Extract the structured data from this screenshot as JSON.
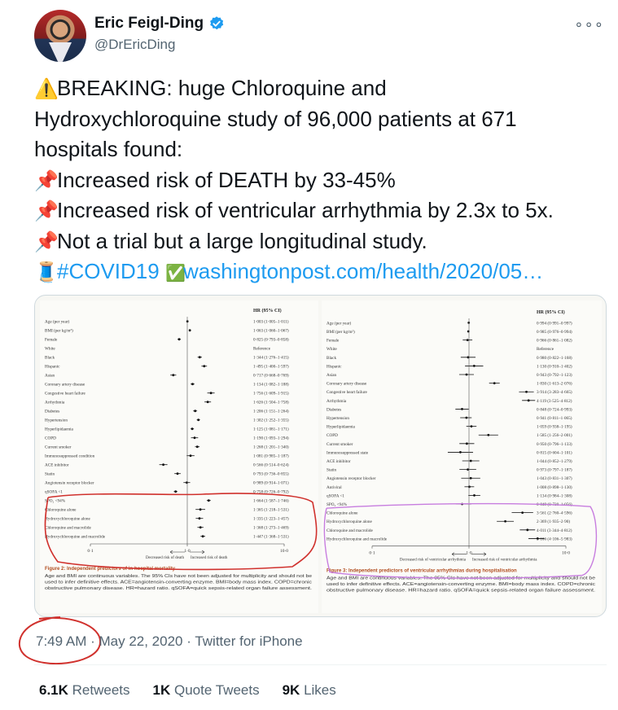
{
  "author": {
    "name": "Eric Feigl-Ding",
    "handle": "@DrEricDing",
    "avatar_icon": "profile-photo",
    "verified_icon": "verified-badge-icon",
    "more_icon": "more-dots-icon"
  },
  "tweet": {
    "line1_emoji": "⚠️",
    "line1_text": "BREAKING: huge Chloroquine and",
    "line2_text": "Hydroxychloroquine study of 96,000 patients at 671",
    "line3_text": "hospitals found:",
    "pin_emoji": "📌",
    "line4_text": "Increased risk of DEATH by 33-45%",
    "line5_text": "Increased risk of ventricular arrhythmia by 2.3x to 5x.",
    "line6_text": "Not a trial but a large longitudinal study.",
    "thread_emoji": "🧵",
    "hashtag": "#COVID19",
    "check_emoji": "✅",
    "link_text": "washingtonpost.com/health/2020/05…"
  },
  "figure_left": {
    "header": "HR (95% CI)",
    "rows": [
      {
        "label": "Age (per year)",
        "ci": "1·003 (1·005–1·011)"
      },
      {
        "label": "BMI (per kg/m²)",
        "ci": "1·063 (1·060–1·067)"
      },
      {
        "label": "Female",
        "ci": "0·825 (0·793–0·858)"
      },
      {
        "label": "White",
        "ci": "Reference"
      },
      {
        "label": "Black",
        "ci": "1·344 (1·276–1·415)"
      },
      {
        "label": "Hispanic",
        "ci": "1·495 (1·400–1·597)"
      },
      {
        "label": "Asian",
        "ci": "0·717 (0·668–0·769)"
      },
      {
        "label": "Coronary artery disease",
        "ci": "1·134 (1·082–1·188)"
      },
      {
        "label": "Congestive heart failure",
        "ci": "1·756 (1·609–1·915)"
      },
      {
        "label": "Arrhythmia",
        "ci": "1·626 (1·504–1·758)"
      },
      {
        "label": "Diabetes",
        "ci": "1·206 (1·151–1·264)"
      },
      {
        "label": "Hypertension",
        "ci": "1·302 (1·252–1·355)"
      },
      {
        "label": "Hyperlipidaemia",
        "ci": "1·125 (1·081–1·171)"
      },
      {
        "label": "COPD",
        "ci": "1·190 (1·093–1·294)"
      },
      {
        "label": "Current smoker",
        "ci": "1·268 (1·201–1·340)"
      },
      {
        "label": "Immunosuppressed condition",
        "ci": "1·081 (0·985–1·187)"
      },
      {
        "label": "ACE inhibitor",
        "ci": "0·566 (0·514–0·624)"
      },
      {
        "label": "Statin",
        "ci": "0·793 (0·736–0·855)"
      },
      {
        "label": "Angiotensin receptor blocker",
        "ci": "0·989 (0·914–1·071)"
      },
      {
        "label": "qSOFA <1",
        "ci": "0·758 (0·726–0·792)"
      },
      {
        "label": "SPO₂ <94%",
        "ci": "1·664 (1·587–1·746)"
      },
      {
        "label": "Chloroquine alone",
        "ci": "1·365 (1·218–1·531)"
      },
      {
        "label": "Hydroxychloroquine alone",
        "ci": "1·335 (1·223–1·457)"
      },
      {
        "label": "Chloroquine and macrolide",
        "ci": "1·368 (1·273–1·469)"
      },
      {
        "label": "Hydroxychloroquine and macrolide",
        "ci": "1·447 (1·368–1·531)"
      }
    ],
    "axis_ticks": [
      "0·1",
      "1·0",
      "10·0"
    ],
    "axis_left_label": "Decreased risk of death",
    "axis_right_label": "Increased risk of death",
    "caption_title": "Figure 2: Independent predictors of in-hospital mortality",
    "caption_body": [
      "Age and BMI are continuous variables. The 95% CIs have not been adjusted for multiplicity and should not be",
      "used to infer definitive effects. ACE=angiotensin-converting enzyme. BMI=body mass index. COPD=chronic",
      "obstructive pulmonary disease. HR=hazard ratio. qSOFA=quick sepsis-related organ failure assessment."
    ]
  },
  "figure_right": {
    "header": "HR (95% CI)",
    "rows": [
      {
        "label": "Age (per year)",
        "ci": "0·994 (0·991–0·997)"
      },
      {
        "label": "BMI (per kg/m²)",
        "ci": "0·985 (0·976–0·994)"
      },
      {
        "label": "Female",
        "ci": "0·966 (0·861–1·082)"
      },
      {
        "label": "White",
        "ci": "Reference"
      },
      {
        "label": "Black",
        "ci": "0·980 (0·822–1·168)"
      },
      {
        "label": "Hispanic",
        "ci": "1·130 (0·910–1·402)"
      },
      {
        "label": "Asian",
        "ci": "0·943 (0·792–1·123)"
      },
      {
        "label": "Coronary artery disease",
        "ci": "1·830 (1·613–2·076)"
      },
      {
        "label": "Congestive heart failure",
        "ci": "3·914 (3·283–4·665)"
      },
      {
        "label": "Arrhythmia",
        "ci": "4·119 (3·525–4·812)"
      },
      {
        "label": "Diabetes",
        "ci": "0·848 (0·724–0·993)"
      },
      {
        "label": "Hypertension",
        "ci": "0·941 (0·811–1·065)"
      },
      {
        "label": "Hyperlipidaemia",
        "ci": "1·059 (0·938–1·195)"
      },
      {
        "label": "COPD",
        "ci": "1·585 (1·256–2·001)"
      },
      {
        "label": "Current smoker",
        "ci": "0·950 (0·796–1·133)"
      },
      {
        "label": "Immunosuppressed state",
        "ci": "0·815 (0·604–1·101)"
      },
      {
        "label": "ACE inhibitor",
        "ci": "1·044 (0·852–1·279)"
      },
      {
        "label": "Statin",
        "ci": "0·973 (0·797–1·187)"
      },
      {
        "label": "Angiotensin receptor blocker",
        "ci": "1·043 (0·831–1·307)"
      },
      {
        "label": "Antiviral",
        "ci": "1·008 (0·898–1·130)"
      },
      {
        "label": "qSOFA <1",
        "ci": "1·134 (0·984–1·308)"
      },
      {
        "label": "SPO₂ <94%",
        "ci": "0·849 (0·730–1·056)"
      },
      {
        "label": "Chloroquine alone",
        "ci": "3·561 (2·760–4·596)"
      },
      {
        "label": "Hydroxychloroquine alone",
        "ci": "2·369 (1·935–2·90)"
      },
      {
        "label": "Chloroquine and macrolide",
        "ci": "4·011 (3·344–4·812)"
      },
      {
        "label": "Hydroxychloroquine and macrolide",
        "ci": "5·106 (4·106–5·983)"
      }
    ],
    "axis_ticks": [
      "0·1",
      "1·0",
      "10·0"
    ],
    "axis_left_label": "Decreased risk of ventricular arrhythmia",
    "axis_right_label": "Increased risk of ventricular arrhythmia",
    "caption_title": "Figure 3: Independent predictors of ventricular arrhythmias during hospitalisation",
    "caption_body": [
      "Age and BMI are continuous variables. The 95% CIs have not been adjusted for multiplicity and should not be",
      "used to infer definitive effects. ACE=angiotensin-converting enzyme. BMI=body mass index. COPD=chronic",
      "obstructive pulmonary disease. HR=hazard ratio. qSOFA=quick sepsis-related organ failure assessment."
    ]
  },
  "meta": {
    "time": "7:49 AM",
    "sep1": " · ",
    "date": "May 22, 2020",
    "sep2": " · ",
    "source": "Twitter for iPhone"
  },
  "stats": {
    "retweets_count": "6.1K",
    "retweets_label": "Retweets",
    "quotes_count": "1K",
    "quotes_label": "Quote Tweets",
    "likes_count": "9K",
    "likes_label": "Likes"
  },
  "colors": {
    "link": "#1d9bf0",
    "verified": "#1d9bf0",
    "annotation_red": "#d0312d",
    "annotation_purple": "#c77ddf"
  }
}
